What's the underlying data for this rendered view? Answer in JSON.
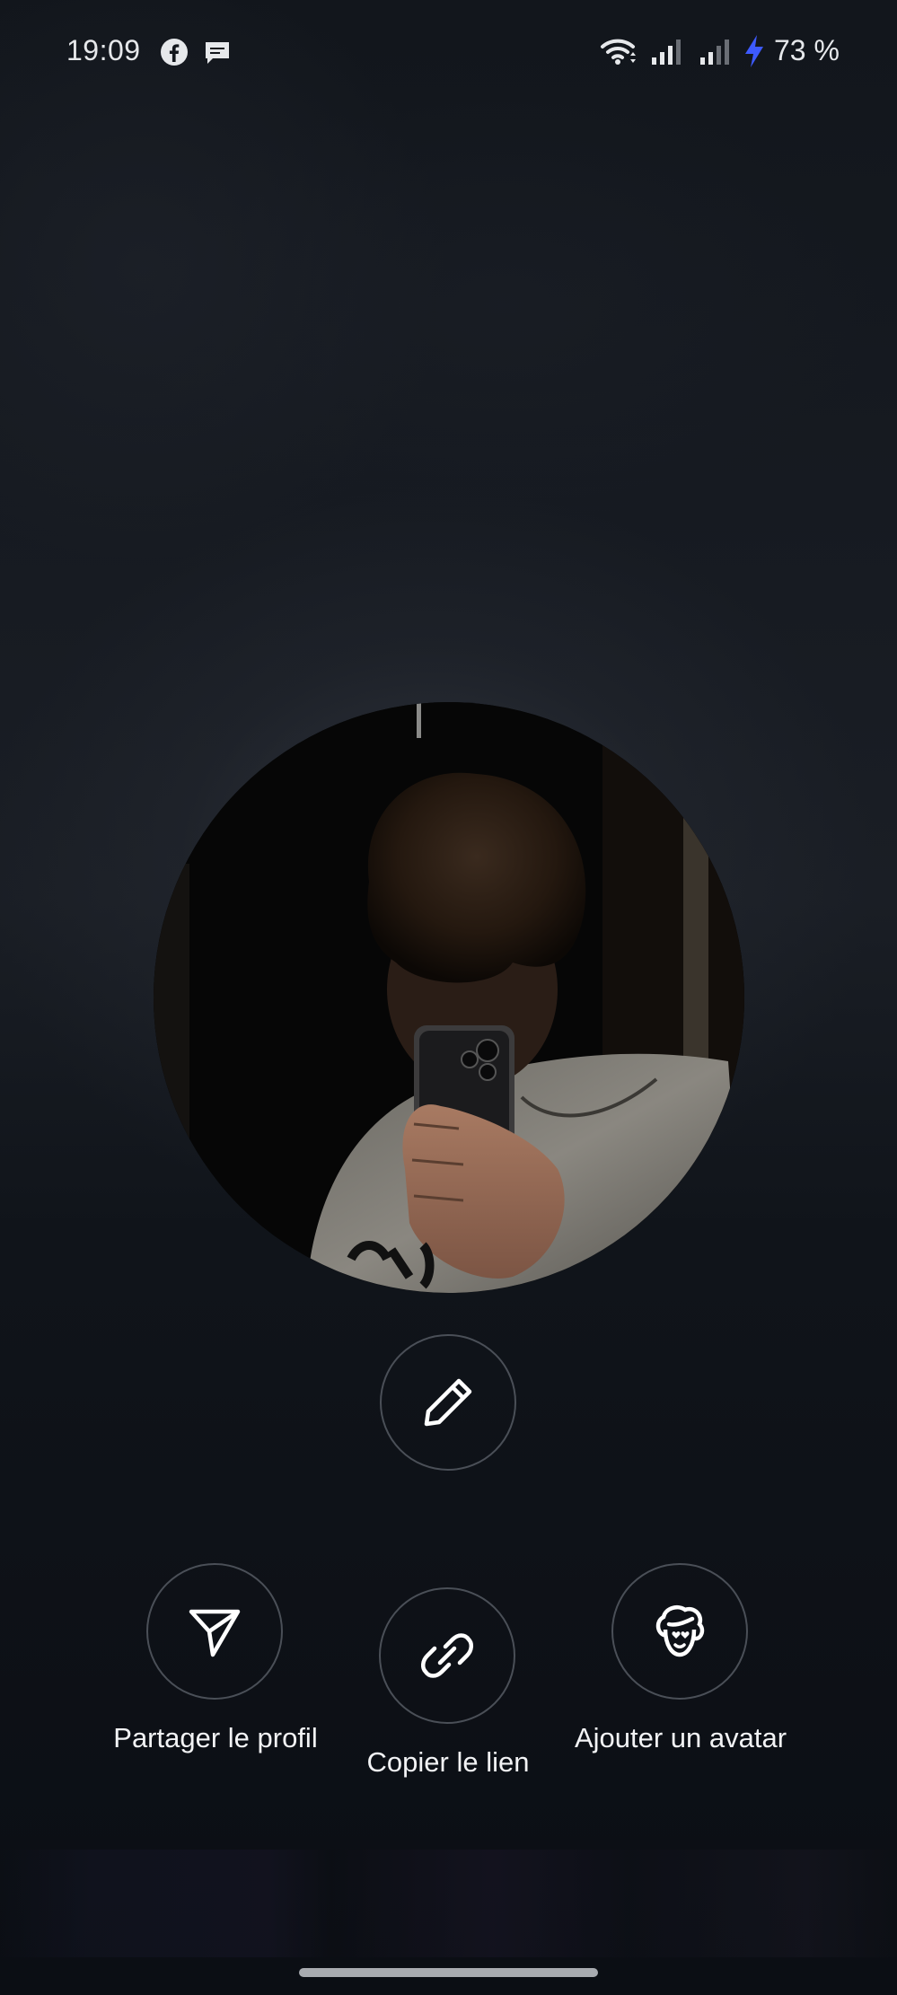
{
  "status_bar": {
    "time": "19:09",
    "battery": "73 %",
    "icons": [
      "facebook-icon",
      "message-icon",
      "wifi-icon",
      "signal-icon",
      "signal-icon",
      "charging-bolt-icon"
    ],
    "bolt_color": "#3d5afe"
  },
  "profile": {
    "avatar_icon": "profile-photo"
  },
  "actions": {
    "edit_icon": "pencil-icon",
    "share_label": "Partager le profil",
    "copy_label": "Copier le lien",
    "avatar_label": "Ajouter un avatar"
  },
  "colors": {
    "background": "#0c1016",
    "button_border": "#4a4f57",
    "text": "#f2f3f5"
  }
}
